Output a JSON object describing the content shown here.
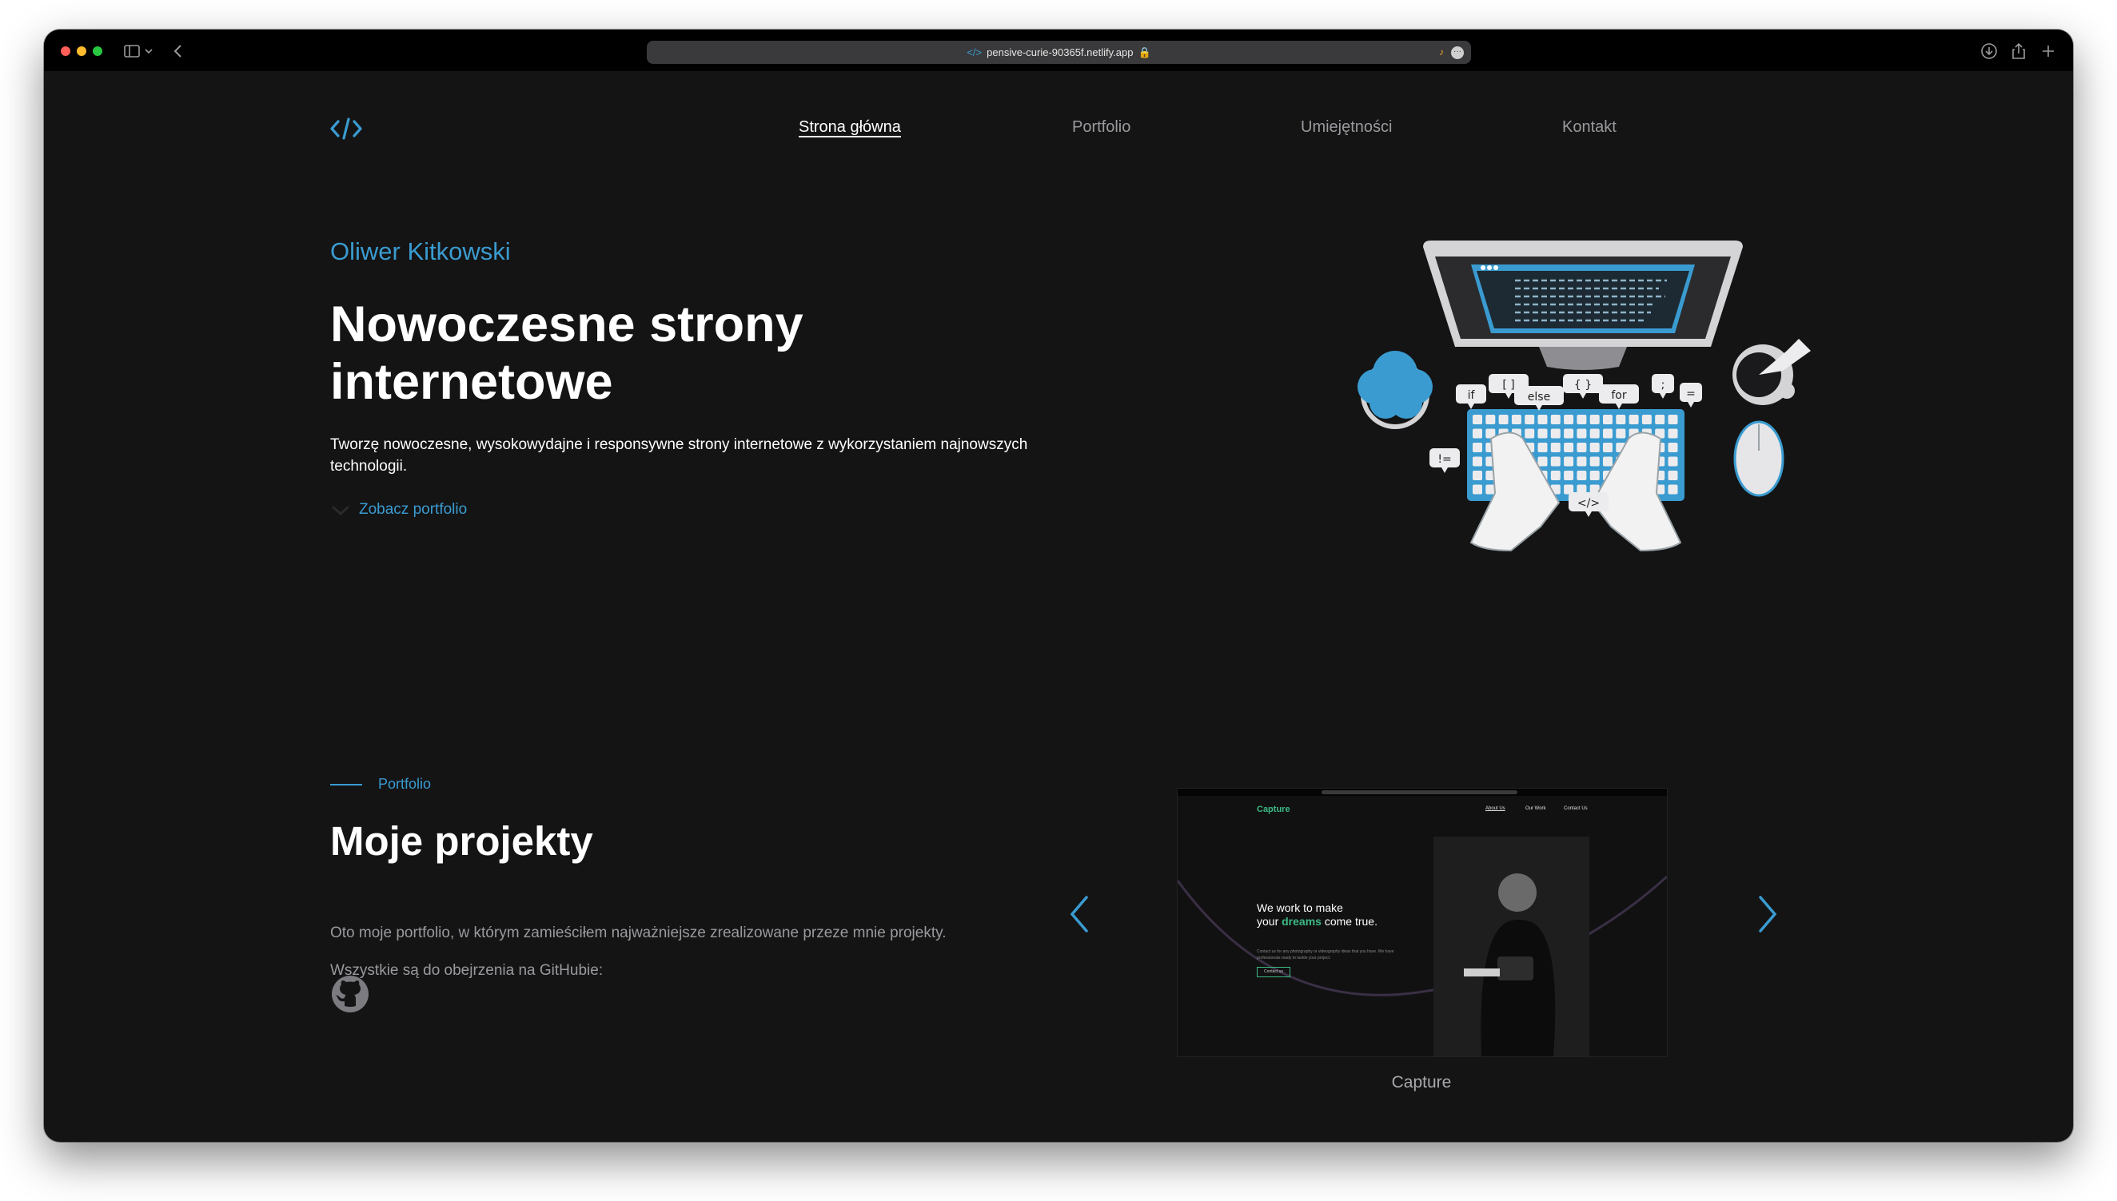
{
  "browser": {
    "url": "pensive-curie-90365f.netlify.app"
  },
  "nav": {
    "items": [
      {
        "label": "Strona główna",
        "active": true
      },
      {
        "label": "Portfolio",
        "active": false
      },
      {
        "label": "Umiejętności",
        "active": false
      },
      {
        "label": "Kontakt",
        "active": false
      }
    ]
  },
  "hero": {
    "name": "Oliwer Kitkowski",
    "title": "Nowoczesne strony internetowe",
    "description": "Tworzę nowoczesne, wysokowydajne i responsywne strony internetowe z wykorzystaniem najnowszych technologii.",
    "cta": "Zobacz portfolio",
    "illustration_labels": [
      "if",
      "[ ]",
      "else",
      "{ }",
      "for",
      ";",
      "=",
      "!=",
      "</>"
    ]
  },
  "portfolio": {
    "label": "Portfolio",
    "title": "Moje projekty",
    "paragraph1": "Oto moje portfolio, w którym zamieściłem najważniejsze zrealizowane przeze mnie projekty.",
    "paragraph2": "Wszystkie są do obejrzenia na GitHubie:",
    "project": {
      "caption": "Capture",
      "preview": {
        "logo": "Capture",
        "nav": [
          "About Us",
          "Our Work",
          "Contact Us"
        ],
        "headline_1": "We work to make",
        "headline_2": "your ",
        "headline_accent": "dreams",
        "headline_3": " come true.",
        "small_text": "Contact us for any photography or videography ideas that you have. We have professionals ready to tackle your project.",
        "button": "Contact us"
      }
    }
  },
  "colors": {
    "accent": "#3a9bd0",
    "background": "#141415",
    "preview_accent": "#3dba84"
  }
}
